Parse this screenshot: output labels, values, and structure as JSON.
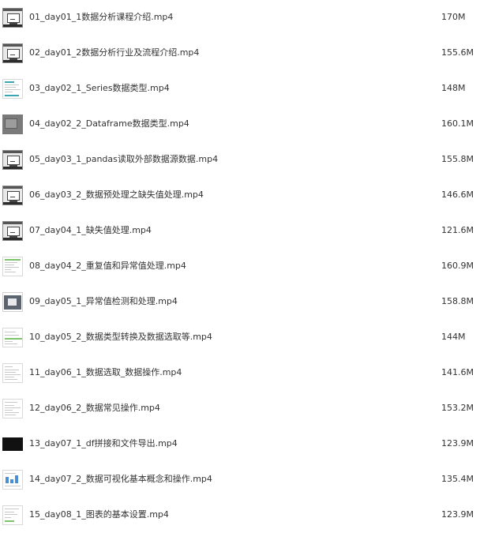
{
  "files": [
    {
      "name": "01_day01_1数据分析课程介绍.mp4",
      "size": "170M",
      "thumb": "player"
    },
    {
      "name": "02_day01_2数据分析行业及流程介绍.mp4",
      "size": "155.6M",
      "thumb": "player"
    },
    {
      "name": "03_day02_1_Series数据类型.mp4",
      "size": "148M",
      "thumb": "doc-teal"
    },
    {
      "name": "04_day02_2_Dataframe数据类型.mp4",
      "size": "160.1M",
      "thumb": "gray"
    },
    {
      "name": "05_day03_1_pandas读取外部数据源数据.mp4",
      "size": "155.8M",
      "thumb": "player"
    },
    {
      "name": "06_day03_2_数据预处理之缺失值处理.mp4",
      "size": "146.6M",
      "thumb": "player"
    },
    {
      "name": "07_day04_1_缺失值处理.mp4",
      "size": "121.6M",
      "thumb": "player"
    },
    {
      "name": "08_day04_2_重复值和异常值处理.mp4",
      "size": "160.9M",
      "thumb": "doc-green"
    },
    {
      "name": "09_day05_1_异常值检测和处理.mp4",
      "size": "158.8M",
      "thumb": "dark"
    },
    {
      "name": "10_day05_2_数据类型转换及数据选取等.mp4",
      "size": "144M",
      "thumb": "doc-green2"
    },
    {
      "name": "11_day06_1_数据选取_数据操作.mp4",
      "size": "141.6M",
      "thumb": "doc-plain"
    },
    {
      "name": "12_day06_2_数据常见操作.mp4",
      "size": "153.2M",
      "thumb": "doc-plain"
    },
    {
      "name": "13_day07_1_df拼接和文件导出.mp4",
      "size": "123.9M",
      "thumb": "black"
    },
    {
      "name": "14_day07_2_数据可视化基本概念和操作.mp4",
      "size": "135.4M",
      "thumb": "doc-chart"
    },
    {
      "name": "15_day08_1_图表的基本设置.mp4",
      "size": "123.9M",
      "thumb": "doc-plain"
    }
  ]
}
